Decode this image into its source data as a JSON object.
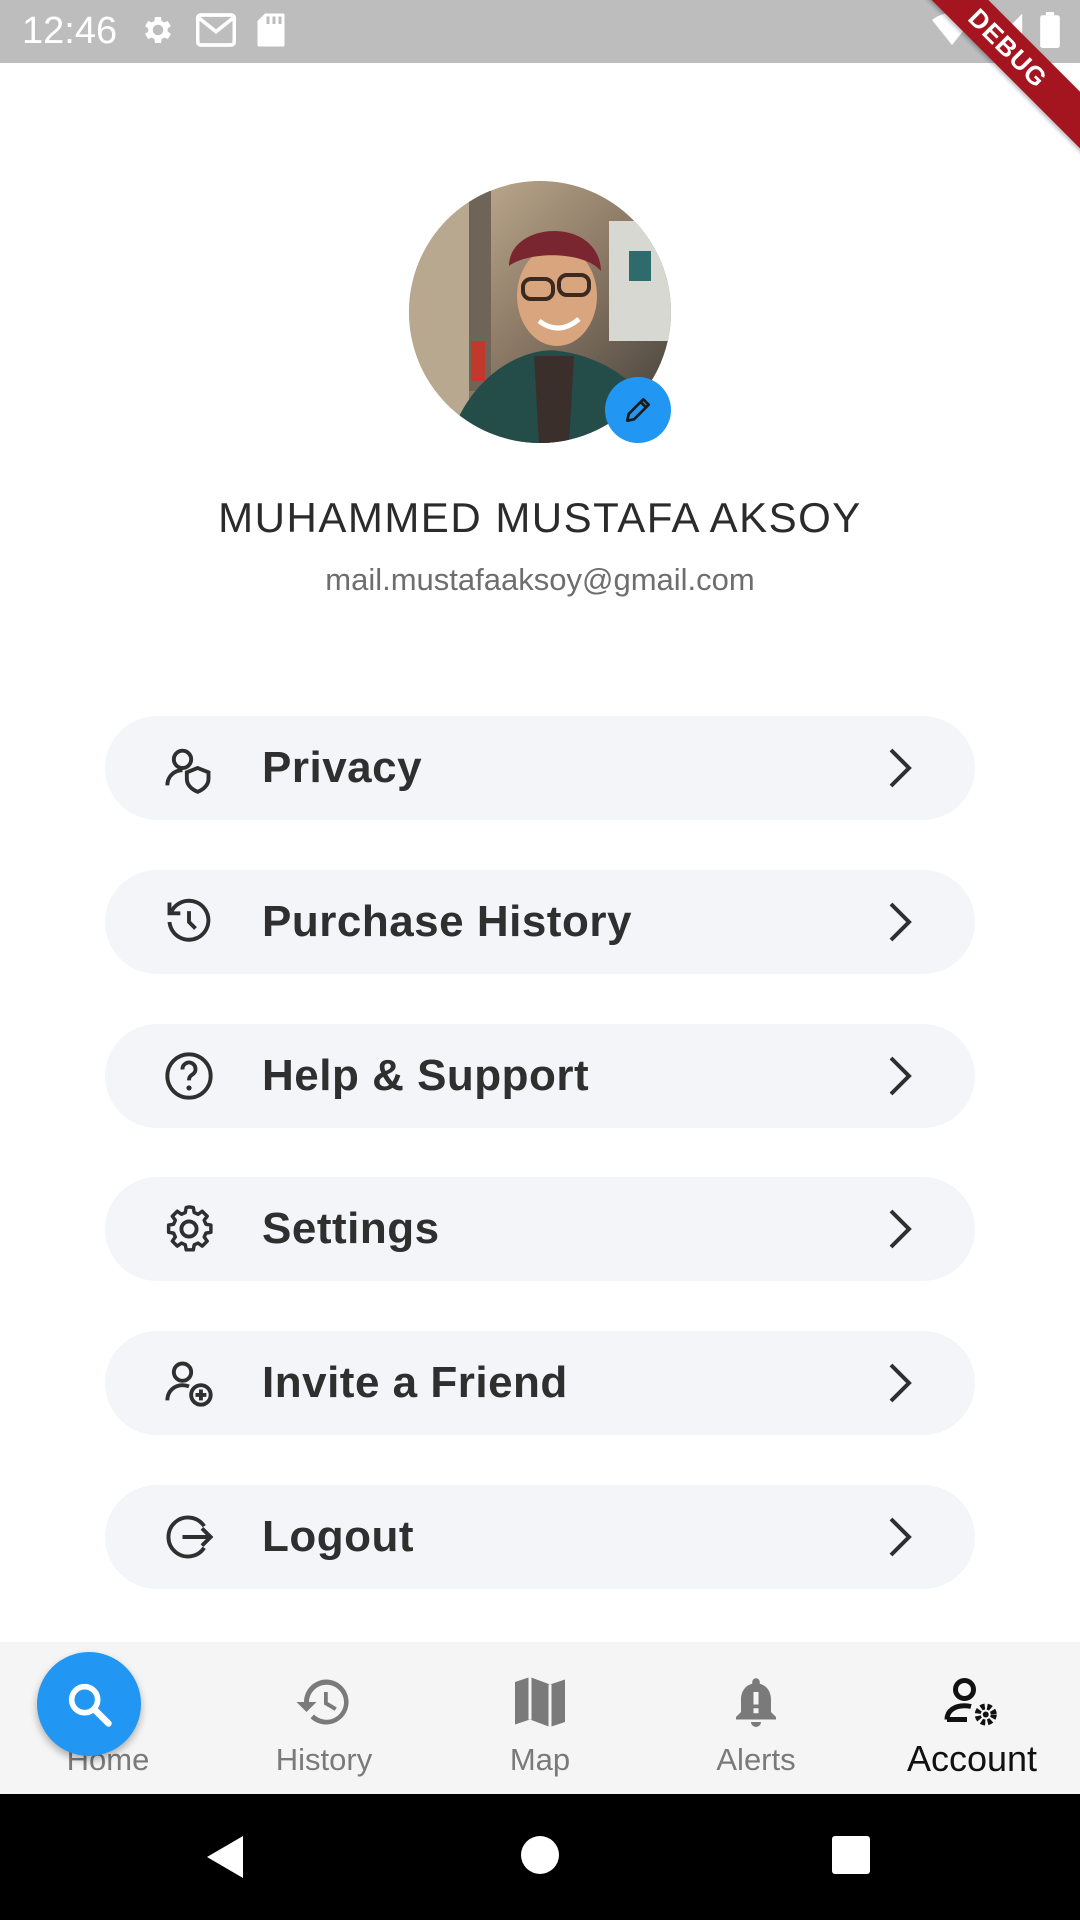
{
  "status_bar": {
    "time": "12:46",
    "left_icons": [
      "gear-icon",
      "gmail-icon",
      "sd-card-icon"
    ],
    "right_icons": [
      "wifi-icon",
      "signal-icon",
      "battery-icon"
    ],
    "debug_label": "DEBUG"
  },
  "profile": {
    "name": "MUHAMMED MUSTAFA AKSOY",
    "email": "mail.mustafaaksoy@gmail.com",
    "edit_icon": "pencil-icon"
  },
  "menu": {
    "items": [
      {
        "label": "Privacy",
        "icon": "user-shield-icon"
      },
      {
        "label": "Purchase History",
        "icon": "history-icon"
      },
      {
        "label": "Help & Support",
        "icon": "help-circle-icon"
      },
      {
        "label": "Settings",
        "icon": "gear-icon"
      },
      {
        "label": "Invite a Friend",
        "icon": "user-plus-icon"
      },
      {
        "label": "Logout",
        "icon": "logout-icon"
      }
    ]
  },
  "bottom_nav": {
    "items": [
      {
        "label": "Home",
        "icon": "home-icon"
      },
      {
        "label": "History",
        "icon": "history-icon"
      },
      {
        "label": "Map",
        "icon": "map-icon"
      },
      {
        "label": "Alerts",
        "icon": "bell-alert-icon"
      },
      {
        "label": "Account",
        "icon": "user-settings-icon"
      }
    ],
    "active": "Account",
    "fab_icon": "search-icon"
  },
  "colors": {
    "accent": "#2196f3",
    "menu_background": "#f3f5f9",
    "debug_ribbon": "#a5151f"
  }
}
